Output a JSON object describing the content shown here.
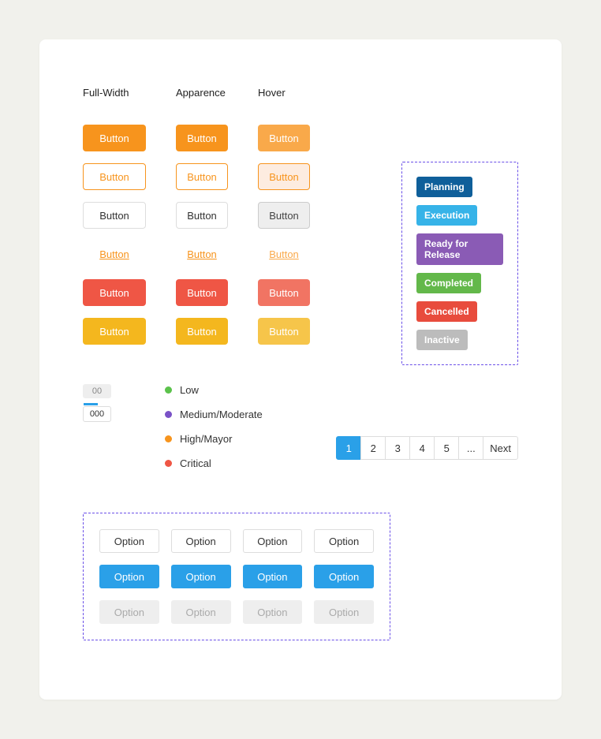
{
  "columns": {
    "fullwidth": "Full-Width",
    "appearance": "Apparence",
    "hover": "Hover"
  },
  "button_label": "Button",
  "tags": [
    {
      "label": "Planning",
      "color": "#0f5f9a"
    },
    {
      "label": "Execution",
      "color": "#36b3e8"
    },
    {
      "label": "Ready for Release",
      "color": "#8a5bb5"
    },
    {
      "label": "Completed",
      "color": "#63b84a"
    },
    {
      "label": "Cancelled",
      "color": "#e84c3d"
    },
    {
      "label": "Inactive",
      "color": "#bcbcbc"
    }
  ],
  "steppers": {
    "inactive": "00",
    "active": "000"
  },
  "severity": [
    {
      "label": "Low",
      "color": "#5bc24b"
    },
    {
      "label": "Medium/Moderate",
      "color": "#7a52c7"
    },
    {
      "label": "High/Mayor",
      "color": "#f7941d"
    },
    {
      "label": "Critical",
      "color": "#ef5645"
    }
  ],
  "pagination": {
    "pages": [
      "1",
      "2",
      "3",
      "4",
      "5",
      "..."
    ],
    "next": "Next",
    "active": "1"
  },
  "option_label": "Option"
}
